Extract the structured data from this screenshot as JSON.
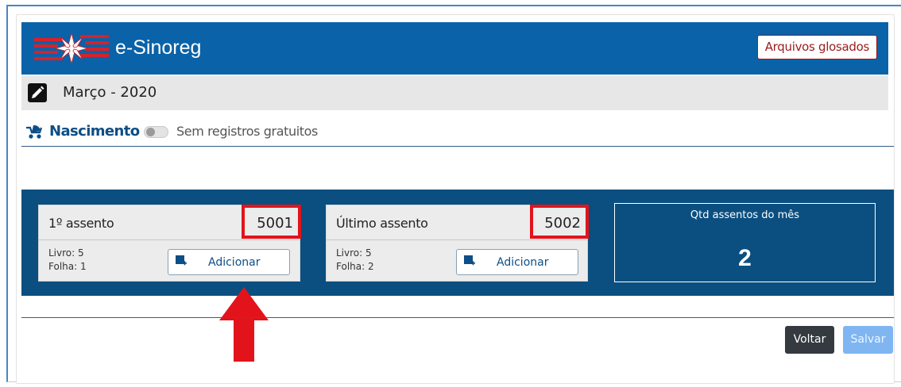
{
  "app": {
    "title": "e-Sinoreg"
  },
  "header": {
    "glosados_label": "Arquivos glosados"
  },
  "period": {
    "title": "Março - 2020"
  },
  "section": {
    "title": "Nascimento",
    "toggle_label": "Sem registros gratuitos",
    "toggle_on": false
  },
  "first_assent": {
    "label": "1º assento",
    "number": "5001",
    "livro": "Livro: 5",
    "folha": "Folha: 1",
    "add_label": "Adicionar"
  },
  "last_assent": {
    "label": "Último assento",
    "number": "5002",
    "livro": "Livro: 5",
    "folha": "Folha: 2",
    "add_label": "Adicionar"
  },
  "summary": {
    "label": "Qtd assentos do mês",
    "value": "2"
  },
  "actions": {
    "back_label": "Voltar",
    "save_label": "Salvar"
  },
  "icons": {
    "logo": "sinoreg-logo-icon",
    "edit": "pencil-edit-icon",
    "section": "stroller-icon",
    "add": "add-image-icon",
    "annotation": "red-arrow-up-icon"
  },
  "colors": {
    "header": "#0a62a8",
    "band": "#0a4f80",
    "highlight": "#e3131b",
    "glosados": "#9b1a1a",
    "save": "#7fb6f2",
    "back": "#343a40"
  }
}
